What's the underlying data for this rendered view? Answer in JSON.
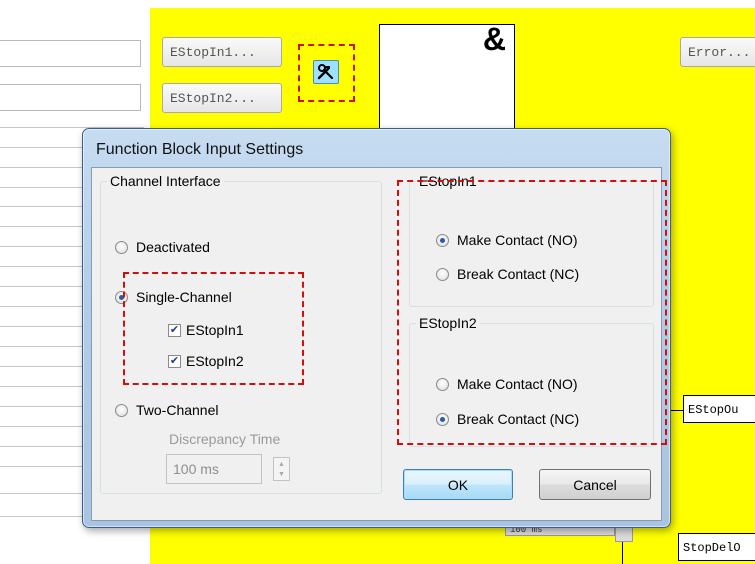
{
  "background": {
    "pin_buttons": [
      "EStopIn1...",
      "EStopIn2..."
    ],
    "error_button": "Error...",
    "logic_symbol": "&",
    "output_boxes": [
      "EStopOu",
      "StopDelO"
    ],
    "time_field": "100 ms",
    "tool_icon": "hammer-wrench-icon"
  },
  "dialog": {
    "title": "Function Block Input Settings",
    "channel_interface": {
      "label": "Channel Interface",
      "deactivated": "Deactivated",
      "single_channel": "Single-Channel",
      "estop_in1": "EStopIn1",
      "estop_in2": "EStopIn2",
      "two_channel": "Two-Channel",
      "discrepancy_label": "Discrepancy Time",
      "discrepancy_value": "100 ms",
      "selected": "single_channel"
    },
    "estop_in1_group": {
      "label": "EStopIn1",
      "make": "Make Contact (NO)",
      "break": "Break Contact (NC)",
      "selected": "make"
    },
    "estop_in2_group": {
      "label": "EStopIn2",
      "make": "Make Contact (NO)",
      "break": "Break Contact (NC)",
      "selected": "break"
    },
    "ok_label": "OK",
    "cancel_label": "Cancel"
  },
  "colors": {
    "canvas": "#ffff00",
    "highlight_dash": "#d01010",
    "dialog_frame": "#b4cde8",
    "radio_dot": "#2a5caa"
  }
}
